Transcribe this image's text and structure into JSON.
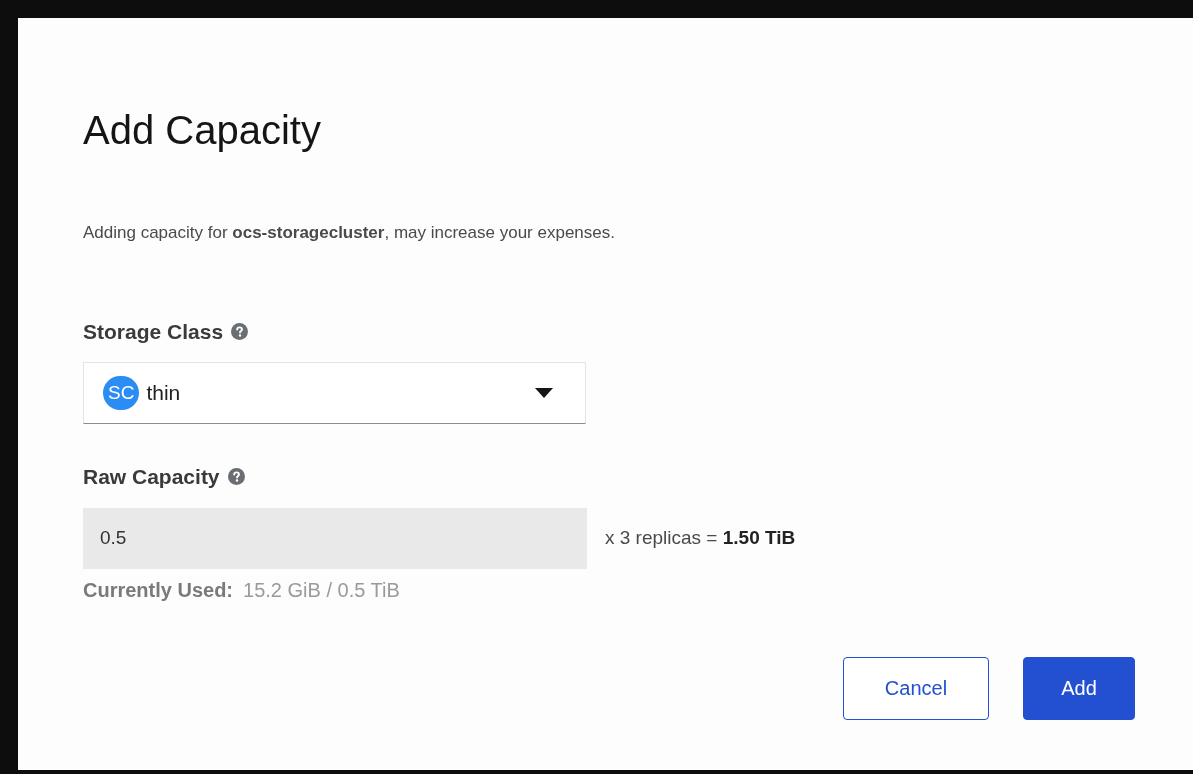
{
  "dialog": {
    "title": "Add Capacity",
    "description": "Adding capacity for **ocs-storagecluster**, may increase your expenses.",
    "storage_class": {
      "label": "Storage Class",
      "badge": "SC",
      "value": "thin"
    },
    "raw_capacity": {
      "label": "Raw Capacity",
      "value": "0.5",
      "multiplier": "x 3 replicas = ",
      "total": "1.50 TiB",
      "used_label": "Currently Used:",
      "used_value": "15.2 GiB / 0.5 TiB"
    },
    "buttons": [
      {
        "label": "Cancel",
        "kind": "secondary"
      },
      {
        "label": "Add",
        "kind": "primary"
      }
    ]
  }
}
